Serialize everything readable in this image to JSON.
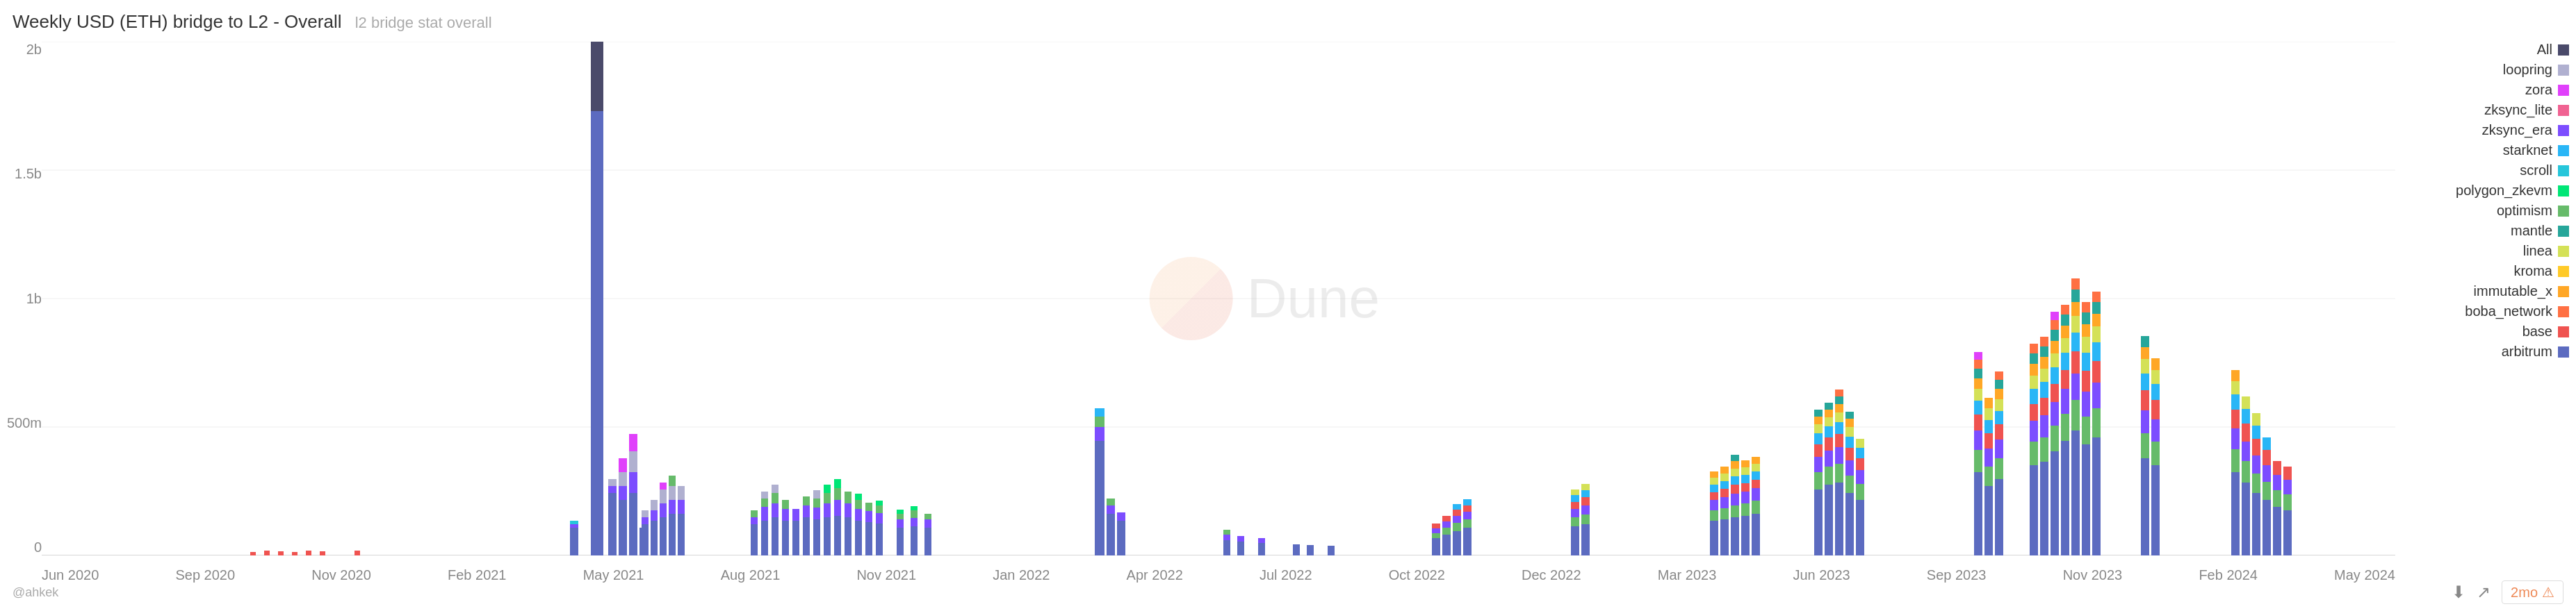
{
  "title": {
    "main": "Weekly USD (ETH) bridge to L2 - Overall",
    "sub": "l2 bridge stat overall"
  },
  "yAxis": {
    "labels": [
      "2b",
      "1.5b",
      "1b",
      "500m",
      "0"
    ]
  },
  "xAxis": {
    "labels": [
      "Jun 2020",
      "Sep 2020",
      "Nov 2020",
      "Feb 2021",
      "May 2021",
      "Aug 2021",
      "Nov 2021",
      "Jan 2022",
      "Apr 2022",
      "Jul 2022",
      "Oct 2022",
      "Dec 2022",
      "Mar 2023",
      "Jun 2023",
      "Sep 2023",
      "Nov 2023",
      "Feb 2024",
      "May 2024"
    ]
  },
  "legend": {
    "items": [
      {
        "label": "All",
        "color": "#4a4a6a"
      },
      {
        "label": "loopring",
        "color": "#b0b0d0"
      },
      {
        "label": "zora",
        "color": "#e040fb"
      },
      {
        "label": "zksync_lite",
        "color": "#f06292"
      },
      {
        "label": "zksync_era",
        "color": "#7c4dff"
      },
      {
        "label": "starknet",
        "color": "#29b6f6"
      },
      {
        "label": "scroll",
        "color": "#26c6da"
      },
      {
        "label": "polygon_zkevm",
        "color": "#00e676"
      },
      {
        "label": "optimism",
        "color": "#66bb6a"
      },
      {
        "label": "mantle",
        "color": "#26a69a"
      },
      {
        "label": "linea",
        "color": "#d4e157"
      },
      {
        "label": "kroma",
        "color": "#ffca28"
      },
      {
        "label": "immutable_x",
        "color": "#ffa726"
      },
      {
        "label": "boba_network",
        "color": "#ff7043"
      },
      {
        "label": "base",
        "color": "#ef5350"
      },
      {
        "label": "arbitrum",
        "color": "#5c6bc0"
      }
    ]
  },
  "watermark": {
    "text": "Dune"
  },
  "attribution": "@ahkek",
  "timeBadge": "2mo",
  "icons": {
    "download": "⬇",
    "share": "↗",
    "warning": "⚠"
  }
}
